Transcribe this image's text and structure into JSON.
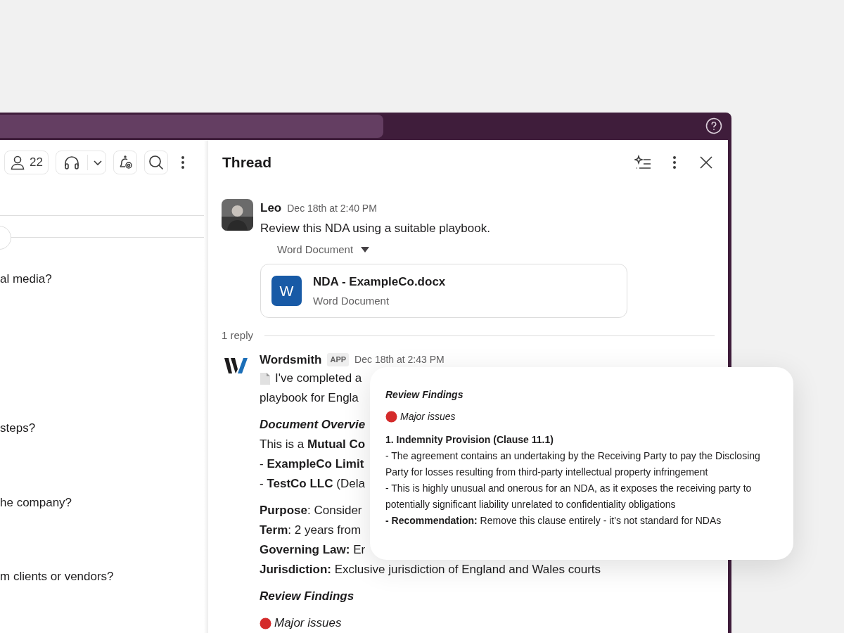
{
  "channel_toolbar": {
    "member_count": "22"
  },
  "channel_messages": [
    {
      "text": "al media?"
    },
    {
      "text": "steps?"
    },
    {
      "text": "he company?"
    },
    {
      "text": "m clients or vendors?"
    }
  ],
  "thread": {
    "title": "Thread",
    "parent": {
      "author": "Leo",
      "time": "Dec 18th at 2:40 PM",
      "text": "Review this NDA using a suitable playbook.",
      "attachment_label": "Word Document",
      "file": {
        "icon_letter": "W",
        "name": "NDA - ExampleCo.docx",
        "type": "Word Document"
      }
    },
    "reply_count": "1 reply",
    "reply": {
      "author": "Wordsmith",
      "badge": "APP",
      "time": "Dec 18th at 2:43 PM",
      "lines": [
        {
          "kind": "lead",
          "text": "I've completed a"
        },
        {
          "kind": "text",
          "text": "playbook for Engla"
        },
        {
          "kind": "heading",
          "text": "Document Overvie"
        },
        {
          "kind": "text",
          "text": "This is a **Mutual Co**"
        },
        {
          "kind": "text",
          "text": "- **ExampleCo Limit**"
        },
        {
          "kind": "text",
          "text": "- **TestCo LLC** (Dela"
        },
        {
          "kind": "gap"
        },
        {
          "kind": "text",
          "text": "**Purpose**: Consider"
        },
        {
          "kind": "text",
          "text": "**Term**: 2 years from"
        },
        {
          "kind": "text",
          "text": "**Governing Law:** Er"
        },
        {
          "kind": "text",
          "text": "**Jurisdiction:** Exclusive jurisdiction of England and Wales courts"
        },
        {
          "kind": "heading",
          "text": "Review Findings"
        },
        {
          "kind": "status",
          "text": "Major issues",
          "color": "#d42b2b"
        }
      ]
    }
  },
  "popup": {
    "lines": [
      {
        "kind": "heading",
        "text": "Review Findings"
      },
      {
        "kind": "status",
        "text": "Major issues",
        "color": "#d42b2b"
      },
      {
        "kind": "title",
        "text": "1. Indemnity Provision (Clause 11.1)"
      },
      {
        "kind": "text",
        "text": "- The agreement contains an undertaking by the Receiving Party to pay the Disclosing Party for losses resulting from third-party intellectual property infringement"
      },
      {
        "kind": "text",
        "text": "- This is highly unusual and onerous for an NDA, as it exposes the receiving party to potentially significant liability unrelated to confidentiality obligations"
      },
      {
        "kind": "text",
        "text": "**- Recommendation:** Remove this clause entirely - it's not standard for NDAs"
      }
    ]
  }
}
